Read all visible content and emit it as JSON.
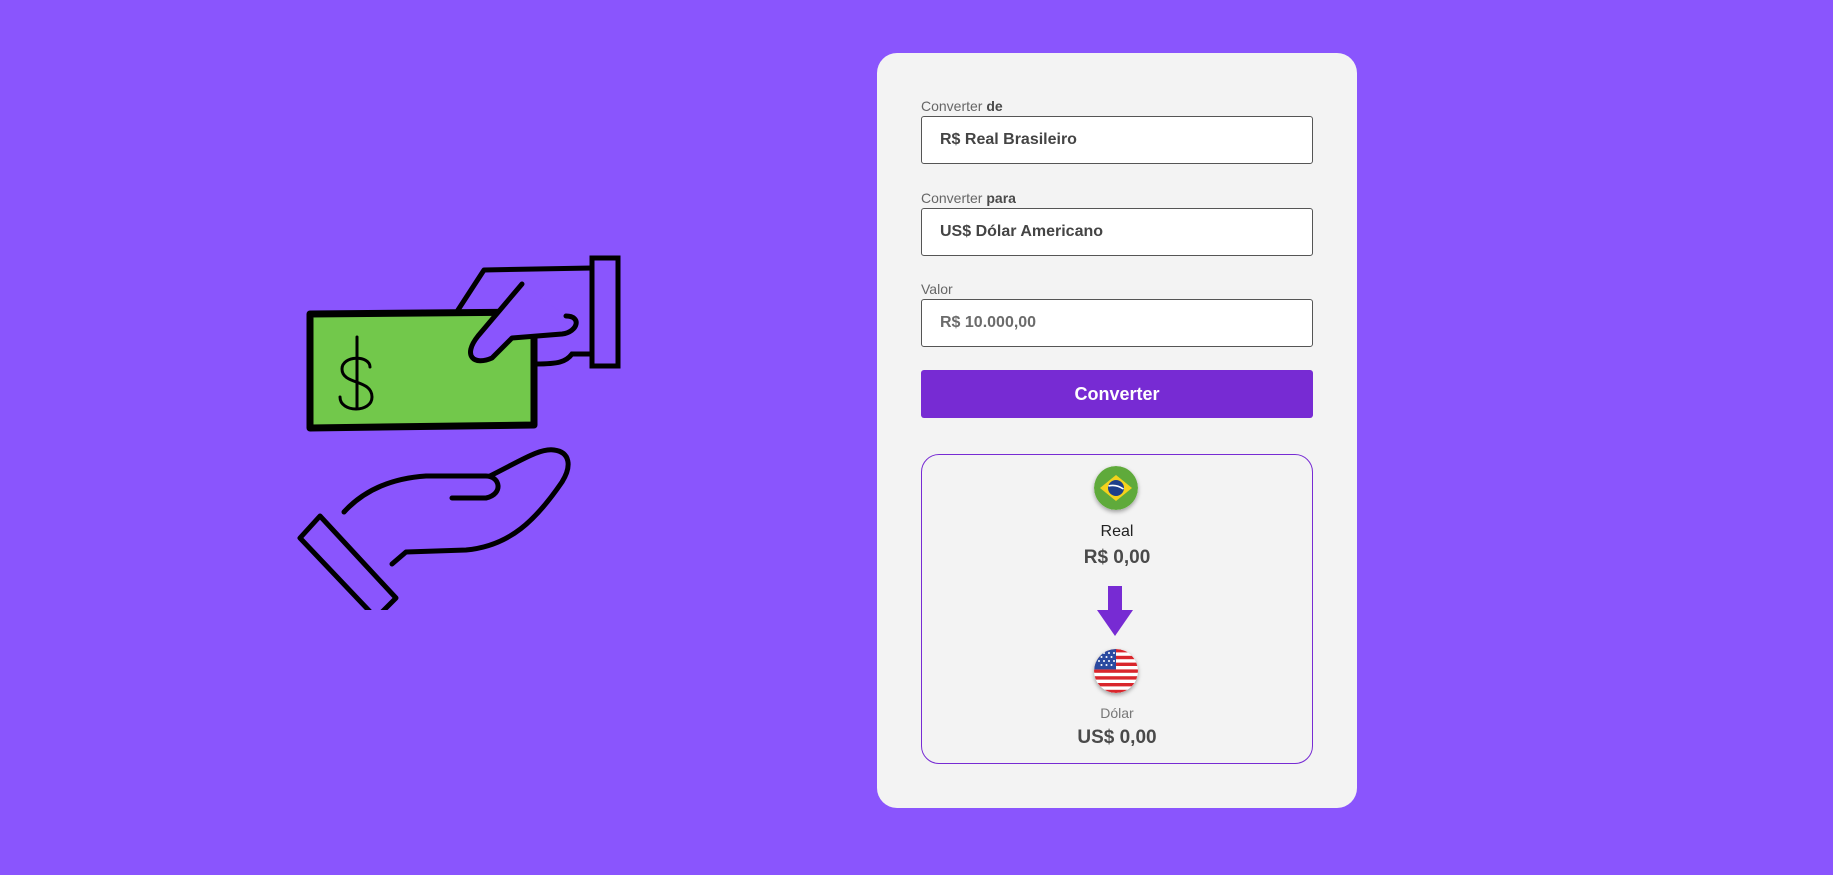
{
  "form": {
    "from_label_prefix": "Converter",
    "from_label_bold": "de",
    "from_value": "R$ Real Brasileiro",
    "to_label_prefix": "Converter",
    "to_label_bold": "para",
    "to_value": "US$ Dólar Americano",
    "amount_label": "Valor",
    "amount_placeholder": "R$ 10.000,00",
    "convert_label": "Converter"
  },
  "result": {
    "from_currency_name": "Real",
    "from_currency_amount": "R$ 0,00",
    "to_currency_name": "Dólar",
    "to_currency_amount": "US$ 0,00"
  },
  "icons": {
    "illustration": "money-hands-illustration",
    "from_flag": "brazil-flag-icon",
    "to_flag": "usa-flag-icon",
    "arrow": "arrow-down-icon"
  },
  "colors": {
    "background": "#8a55fd",
    "card": "#f3f3f3",
    "accent": "#772bd3",
    "money_green": "#72c84b"
  }
}
